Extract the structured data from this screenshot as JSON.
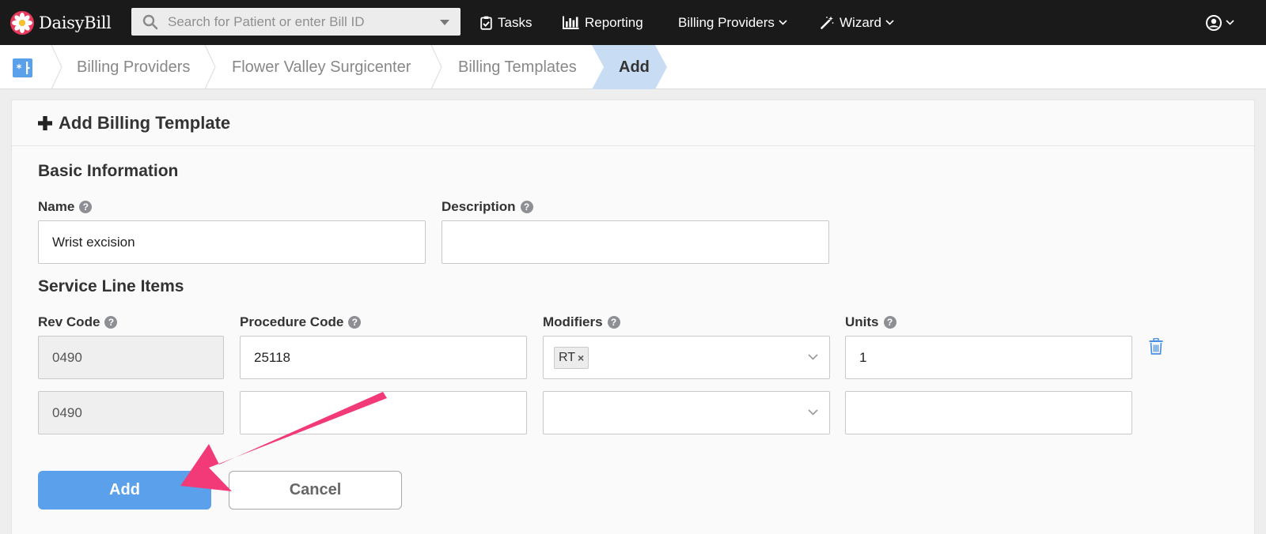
{
  "navbar": {
    "brand": "DaisyBill",
    "search_placeholder": "Search for Patient or enter Bill ID",
    "tasks": "Tasks",
    "reporting": "Reporting",
    "billing_providers": "Billing Providers",
    "wizard": "Wizard"
  },
  "breadcrumb": {
    "items": [
      "Billing Providers",
      "Flower Valley Surgicenter",
      "Billing Templates"
    ],
    "active": "Add"
  },
  "card": {
    "title": "Add Billing Template"
  },
  "basic_info": {
    "title": "Basic Information",
    "name_label": "Name",
    "name_value": "Wrist excision",
    "description_label": "Description",
    "description_value": ""
  },
  "service_lines": {
    "title": "Service Line Items",
    "columns": {
      "rev_code": "Rev Code",
      "procedure_code": "Procedure Code",
      "modifiers": "Modifiers",
      "units": "Units"
    },
    "rows": [
      {
        "rev_code": "0490",
        "procedure_code": "25118",
        "modifiers": [
          "RT"
        ],
        "units": "1"
      },
      {
        "rev_code": "0490",
        "procedure_code": "",
        "modifiers": [],
        "units": ""
      }
    ]
  },
  "actions": {
    "add": "Add",
    "cancel": "Cancel"
  },
  "colors": {
    "navbar": "#1a1a1a",
    "primary": "#5aa0ea",
    "active_crumb": "#c8ddf3",
    "annotation_arrow": "#f23a78",
    "trash_icon": "#4a90e2"
  },
  "icons": {
    "logo": "daisy-logo-icon",
    "search": "search-icon",
    "tasks": "clipboard-check-icon",
    "reporting": "bar-chart-icon",
    "wizard": "magic-wand-icon",
    "user": "user-circle-icon",
    "home": "billing-home-icon",
    "add": "plus-icon",
    "help": "question-circle-icon",
    "delete": "trash-icon"
  }
}
